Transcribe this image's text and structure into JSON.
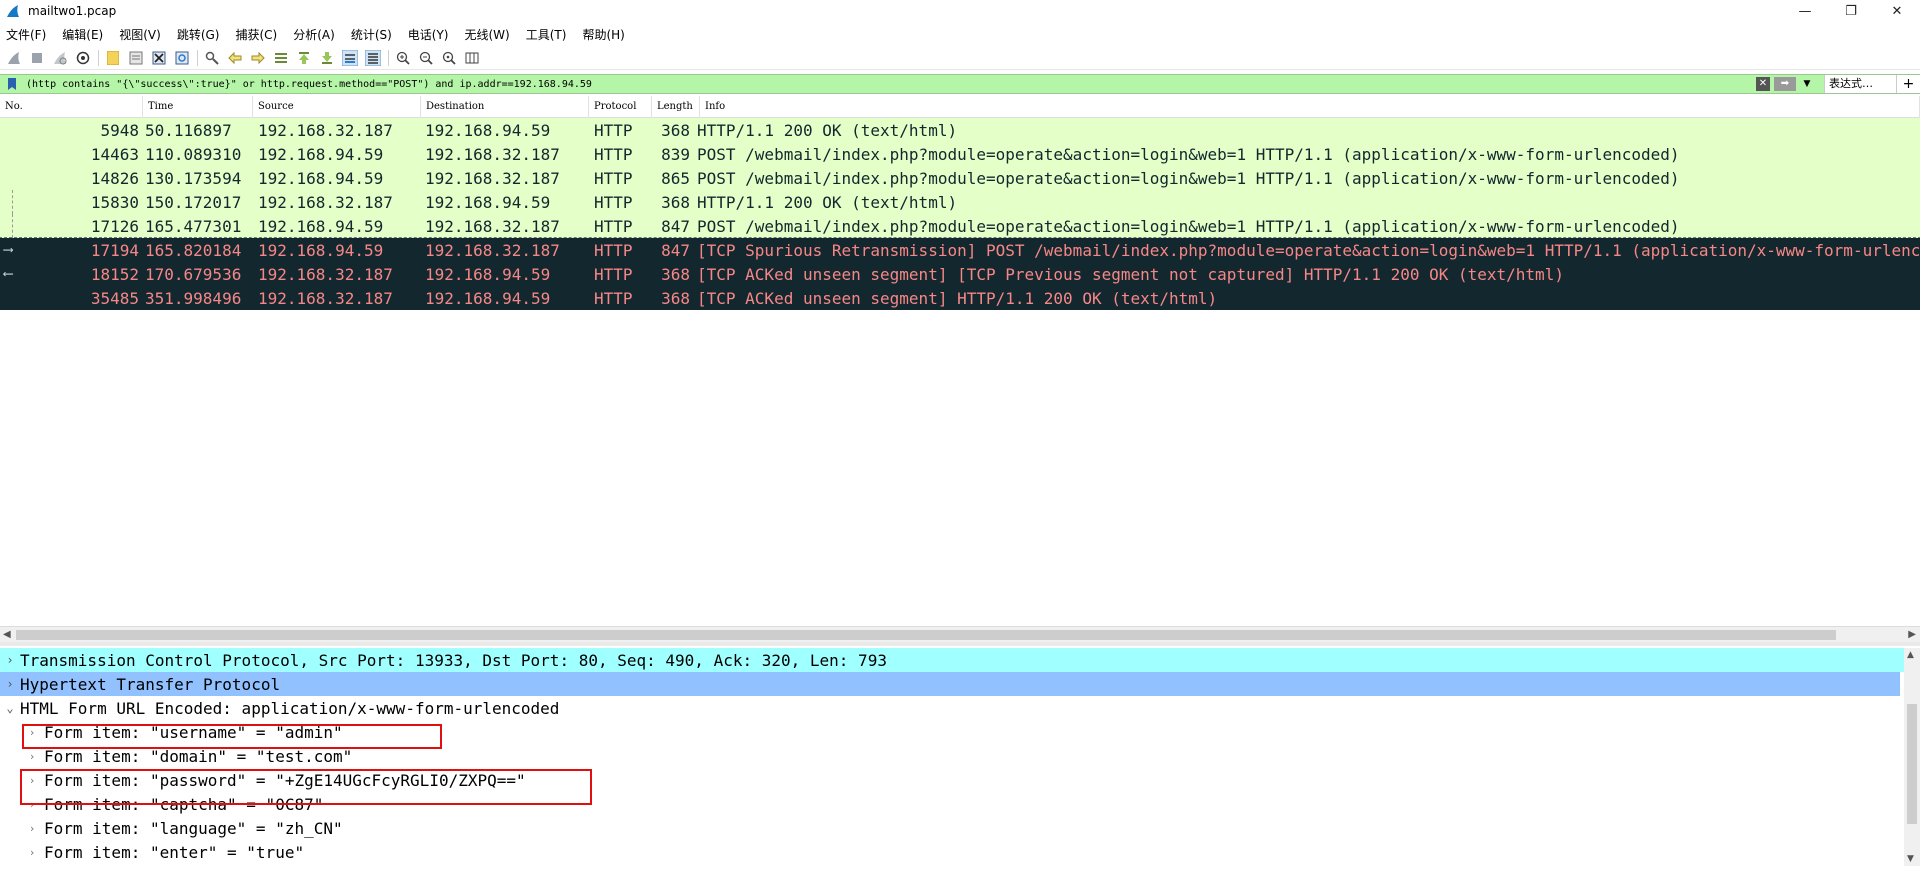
{
  "window": {
    "title": "mailtwo1.pcap",
    "controls": {
      "minimize": "—",
      "maximize": "❐",
      "close": "✕"
    }
  },
  "menu": [
    "文件(F)",
    "编辑(E)",
    "视图(V)",
    "跳转(G)",
    "捕获(C)",
    "分析(A)",
    "统计(S)",
    "电话(Y)",
    "无线(W)",
    "工具(T)",
    "帮助(H)"
  ],
  "toolbar": {
    "icons": [
      "shark-start-icon",
      "stop-icon",
      "restart-icon",
      "capture-options-icon",
      "open-file-icon",
      "save-file-icon",
      "close-file-icon",
      "reload-icon",
      "find-packet-icon",
      "go-back-icon",
      "go-forward-icon",
      "go-to-packet-icon",
      "go-first-icon",
      "go-last-icon",
      "auto-scroll-icon",
      "colorize-icon",
      "zoom-in-icon",
      "zoom-out-icon",
      "zoom-normal-icon",
      "resize-columns-icon"
    ]
  },
  "filter": {
    "expression": "(http contains \"{\\\"success\\\":true}\" or http.request.method==\"POST\") and ip.addr==192.168.94.59",
    "expression_button": "表达式…",
    "add_button": "+"
  },
  "packet_list": {
    "columns": [
      "No.",
      "Time",
      "Source",
      "Destination",
      "Protocol",
      "Length",
      "Info"
    ],
    "rows": [
      {
        "no": "5948",
        "time": "50.116897",
        "src": "192.168.32.187",
        "dst": "192.168.94.59",
        "proto": "HTTP",
        "len": "368",
        "info": "HTTP/1.1 200 OK  (text/html)",
        "style": "http"
      },
      {
        "no": "14463",
        "time": "110.089310",
        "src": "192.168.94.59",
        "dst": "192.168.32.187",
        "proto": "HTTP",
        "len": "839",
        "info": "POST /webmail/index.php?module=operate&action=login&web=1 HTTP/1.1  (application/x-www-form-urlencoded)",
        "style": "http"
      },
      {
        "no": "14826",
        "time": "130.173594",
        "src": "192.168.94.59",
        "dst": "192.168.32.187",
        "proto": "HTTP",
        "len": "865",
        "info": "POST /webmail/index.php?module=operate&action=login&web=1 HTTP/1.1  (application/x-www-form-urlencoded)",
        "style": "http"
      },
      {
        "no": "15830",
        "time": "150.172017",
        "src": "192.168.32.187",
        "dst": "192.168.94.59",
        "proto": "HTTP",
        "len": "368",
        "info": "HTTP/1.1 200 OK  (text/html)",
        "style": "http"
      },
      {
        "no": "17126",
        "time": "165.477301",
        "src": "192.168.94.59",
        "dst": "192.168.32.187",
        "proto": "HTTP",
        "len": "847",
        "info": "POST /webmail/index.php?module=operate&action=login&web=1 HTTP/1.1  (application/x-www-form-urlencoded)",
        "style": "http"
      },
      {
        "no": "17194",
        "time": "165.820184",
        "src": "192.168.94.59",
        "dst": "192.168.32.187",
        "proto": "HTTP",
        "len": "847",
        "info": "[TCP Spurious Retransmission] POST /webmail/index.php?module=operate&action=login&web=1 HTTP/1.1  (application/x-www-form-urlencoded)",
        "style": "bad"
      },
      {
        "no": "18152",
        "time": "170.679536",
        "src": "192.168.32.187",
        "dst": "192.168.94.59",
        "proto": "HTTP",
        "len": "368",
        "info": "[TCP ACKed unseen segment] [TCP Previous segment not captured] HTTP/1.1 200 OK  (text/html)",
        "style": "bad"
      },
      {
        "no": "35485",
        "time": "351.998496",
        "src": "192.168.32.187",
        "dst": "192.168.94.59",
        "proto": "HTTP",
        "len": "368",
        "info": "[TCP ACKed unseen segment] HTTP/1.1 200 OK  (text/html)",
        "style": "bad"
      }
    ]
  },
  "details": {
    "tcp": "Transmission Control Protocol, Src Port: 13933, Dst Port: 80, Seq: 490, Ack: 320, Len: 793",
    "http": "Hypertext Transfer Protocol",
    "form": "HTML Form URL Encoded: application/x-www-form-urlencoded",
    "items": [
      "Form item: \"username\" = \"admin\"",
      "Form item: \"domain\" = \"test.com\"",
      "Form item: \"password\" = \"+ZgE14UGcFcyRGLI0/ZXPQ==\"",
      "Form item: \"captcha\" = \"0C87\"",
      "Form item: \"language\" = \"zh_CN\"",
      "Form item: \"enter\" = \"true\""
    ]
  },
  "colors": {
    "http_row_bg": "#e4ffc7",
    "bad_row_bg": "#12272e",
    "bad_row_fg": "#f78787",
    "filter_bg": "#b5f5a7",
    "tcp_detail_bg": "#a0ffff",
    "http_detail_bg": "#91c2ff",
    "highlight_box": "#e01010"
  }
}
